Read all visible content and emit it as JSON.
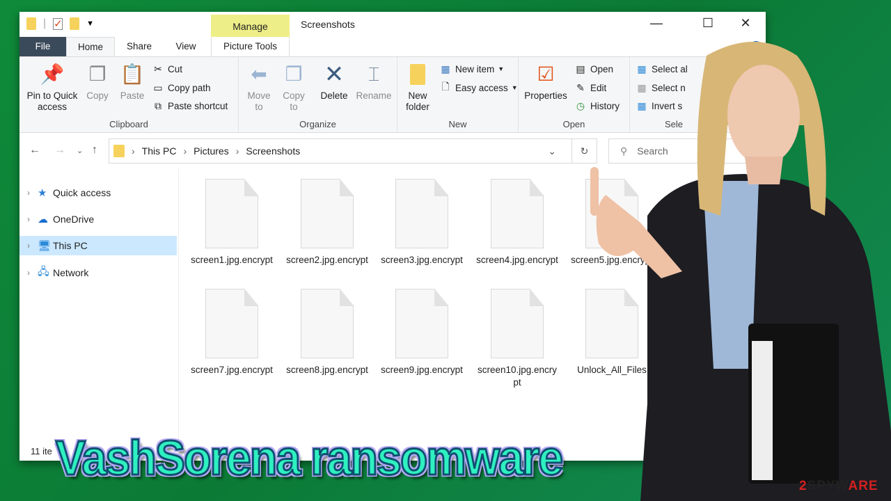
{
  "window": {
    "title": "Screenshots",
    "context_tab": "Manage",
    "context_subtab": "Picture Tools",
    "controls": {
      "minimize": "—",
      "maximize": "☐",
      "close": "✕"
    },
    "help": "?"
  },
  "tabs": [
    "File",
    "Home",
    "Share",
    "View"
  ],
  "ribbon": {
    "clipboard": {
      "label": "Clipboard",
      "pin": "Pin to Quick access",
      "copy": "Copy",
      "paste": "Paste",
      "cut": "Cut",
      "copy_path": "Copy path",
      "paste_shortcut": "Paste shortcut"
    },
    "organize": {
      "label": "Organize",
      "move_to": "Move to",
      "copy_to": "Copy to",
      "delete": "Delete",
      "rename": "Rename"
    },
    "new": {
      "label": "New",
      "new_folder": "New folder",
      "new_item": "New item",
      "easy_access": "Easy access"
    },
    "open": {
      "label": "Open",
      "properties": "Properties",
      "open": "Open",
      "edit": "Edit",
      "history": "History"
    },
    "select": {
      "label": "Sele",
      "select_all": "Select al",
      "select_none": "Select n",
      "invert": "Invert s"
    }
  },
  "address": {
    "path": [
      "This PC",
      "Pictures",
      "Screenshots"
    ],
    "search_placeholder": "Search"
  },
  "nav": [
    {
      "label": "Quick access",
      "icon": "star-icon"
    },
    {
      "label": "OneDrive",
      "icon": "cloud-icon"
    },
    {
      "label": "This PC",
      "icon": "computer-icon",
      "selected": true
    },
    {
      "label": "Network",
      "icon": "network-icon"
    }
  ],
  "files": [
    "screen1.jpg.encrypt",
    "screen2.jpg.encrypt",
    "screen3.jpg.encrypt",
    "screen4.jpg.encrypt",
    "screen5.jpg.encrypt",
    "screen7.jpg.encrypt",
    "screen8.jpg.encrypt",
    "screen9.jpg.encrypt",
    "screen10.jpg.encrypt",
    "Unlock_All_Files"
  ],
  "status": "11 ite",
  "banner": "VashSorena ransomware",
  "logo": "2SPYWARE",
  "colors": {
    "file_tab": "#3b4a5a",
    "manage": "#eeee88",
    "selected": "#cce8ff",
    "banner_fill": "#2ef0c0",
    "background": "#0f8a3a"
  }
}
